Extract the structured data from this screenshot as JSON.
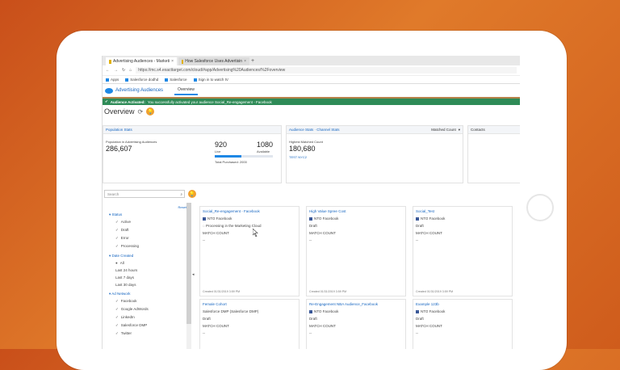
{
  "browser": {
    "tabs": [
      {
        "title": "Advertising Audiences - Marketi",
        "active": true
      },
      {
        "title": "How Salesforce Uses Advertisin",
        "active": false
      }
    ],
    "new_tab": "+",
    "url": "https://mc.s4.exacttarget.com/cloud/#app/Advertising%20Audiences/%2Foverview",
    "bookmarks": [
      "Apps",
      "Salesforce dodhd",
      "Salesforce",
      "Sign in to watch tV"
    ]
  },
  "app": {
    "name": "Advertising Audiences",
    "tab": "Overview",
    "banner_strong": "Audience Activated:",
    "banner_text": "You successfully activated your audience Social_Re-engagement - Facebook",
    "page_title": "Overview"
  },
  "population": {
    "header": "Population Stats",
    "label": "Population in Advertising Audiences",
    "value": "286,607",
    "live_value": "920",
    "live_label": "Live",
    "available_value": "1080",
    "available_label": "Available",
    "total_label": "Total Purchased: 2000",
    "live_fraction": 0.46
  },
  "audience": {
    "header": "Audience Stats · Channel Stats",
    "dropdown": "Matched Count",
    "label": "Highest Matched Count",
    "value": "180,680",
    "sub": "TEST NYC2"
  },
  "contacts": {
    "header": "Contacts"
  },
  "search": {
    "placeholder": "Search"
  },
  "filters": {
    "reset": "Reset",
    "groups": [
      {
        "title": "Status",
        "items": [
          "Active",
          "Draft",
          "Error",
          "Processing"
        ]
      },
      {
        "title": "Date Created",
        "items": [
          "All",
          "Last 24 hours",
          "Last 7 days",
          "Last 30 days"
        ]
      },
      {
        "title": "Ad Network",
        "items": [
          "Facebook",
          "Google AdWords",
          "LinkedIn",
          "Salesforce DMP",
          "Twitter"
        ]
      }
    ]
  },
  "cards": [
    {
      "title": "Social_Re-engagement - Facebook",
      "network": "NTO Facebook",
      "status": "Processing in the Marketing Cloud",
      "count_label": "MATCH COUNT",
      "count": "--",
      "created": "Created 01/31/2019 3:59 PM"
    },
    {
      "title": "High Value Spree Cost",
      "network": "NTO Facebook",
      "status": "Draft",
      "count_label": "MATCH COUNT",
      "count": "--",
      "created": "Created 01/31/2019 3:59 PM"
    },
    {
      "title": "Social_Test",
      "network": "NTO Facebook",
      "status": "Draft",
      "count_label": "MATCH COUNT",
      "count": "--",
      "created": "Created 01/31/2019 3:59 PM"
    },
    {
      "title": "Female Cohort",
      "network": "Salesforce DMP (Salesforce DMP)",
      "status": "Draft",
      "count_label": "MATCH COUNT",
      "count": "--",
      "created": ""
    },
    {
      "title": "Re-Engagement NBA Audience_Facebook",
      "network": "NTO Facebook",
      "status": "Draft",
      "count_label": "MATCH COUNT",
      "count": "--",
      "created": ""
    },
    {
      "title": "Example 123b",
      "network": "NTO Facebook",
      "status": "Draft",
      "count_label": "MATCH COUNT",
      "count": "--",
      "created": ""
    }
  ]
}
